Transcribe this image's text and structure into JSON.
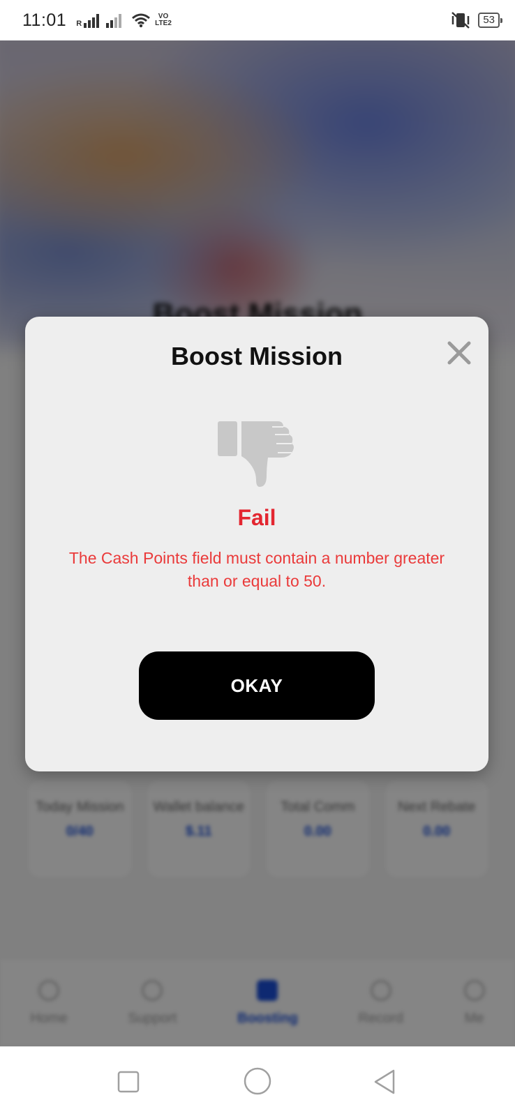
{
  "status_bar": {
    "time": "11:01",
    "roaming": "R",
    "volte_top": "VO",
    "volte_bottom": "LTE2",
    "battery": "53"
  },
  "background": {
    "title": "Boost Mission",
    "stats": [
      {
        "label": "Today Mission",
        "value": "0/40"
      },
      {
        "label": "Wallet balance",
        "value": "$.11"
      },
      {
        "label": "Total Comm",
        "value": "0.00"
      },
      {
        "label": "Next Rebate",
        "value": "0.00"
      }
    ],
    "nav": [
      {
        "label": "Home"
      },
      {
        "label": "Support"
      },
      {
        "label": "Boosting"
      },
      {
        "label": "Record"
      },
      {
        "label": "Me"
      }
    ]
  },
  "dialog": {
    "title": "Boost Mission",
    "status": "Fail",
    "message": "The Cash Points field must contain a number greater than or equal to 50.",
    "button_label": "OKAY",
    "icon": "thumbs-down-icon"
  },
  "colors": {
    "fail_red": "#e32630",
    "message_red": "#ea3a3a",
    "button_bg": "#000000",
    "dialog_bg": "#eeeeee",
    "accent_blue": "#1b4fd8"
  }
}
